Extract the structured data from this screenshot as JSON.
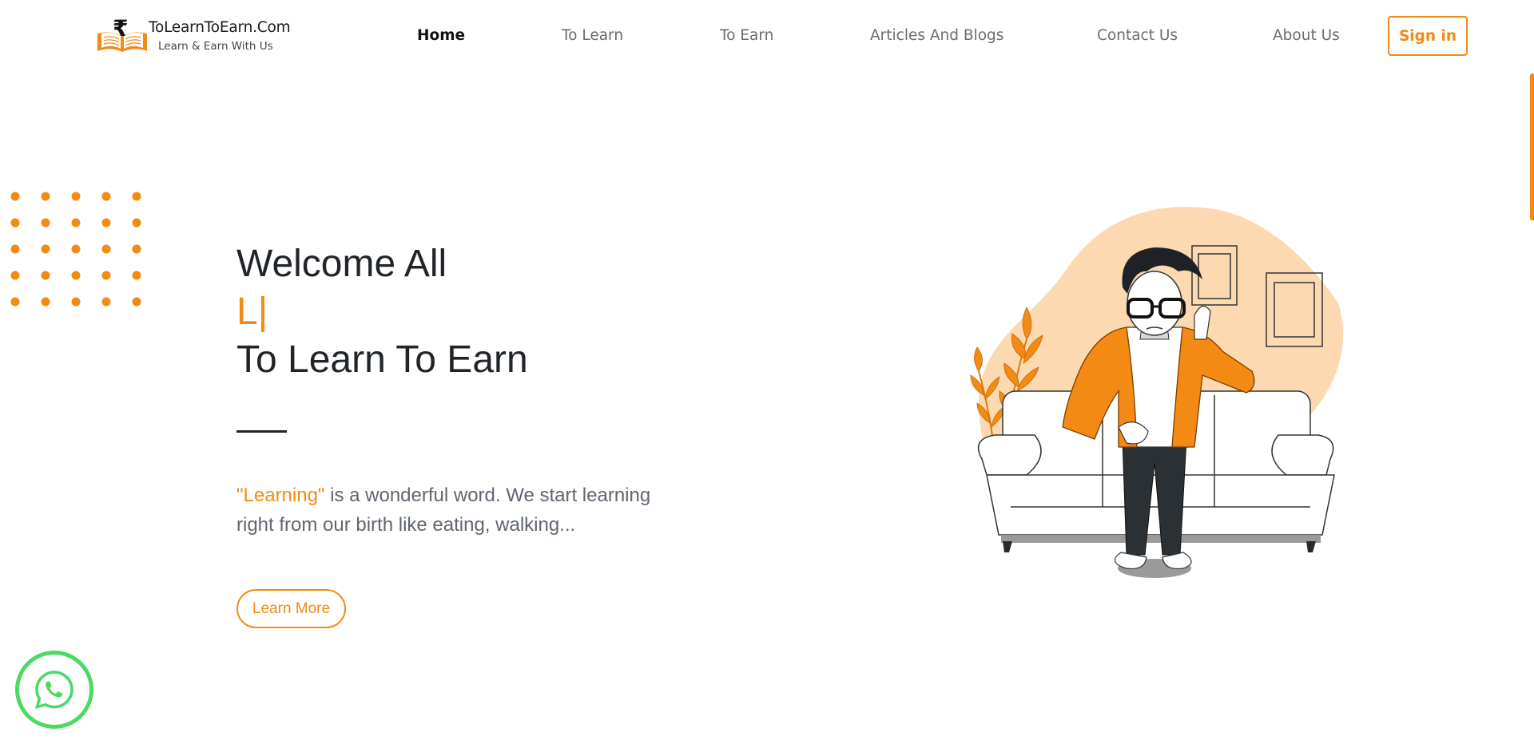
{
  "brand": {
    "name": "ToLearnToEarn.Com",
    "tagline": "Learn & Earn With Us",
    "logo_icon": "open-book-rupee-icon"
  },
  "nav": {
    "items": [
      {
        "label": "Home",
        "active": true
      },
      {
        "label": "To Learn",
        "active": false
      },
      {
        "label": "To Earn",
        "active": false
      },
      {
        "label": "Articles And Blogs",
        "active": false
      },
      {
        "label": "Contact Us",
        "active": false
      },
      {
        "label": "About Us",
        "active": false
      }
    ],
    "signin_label": "Sign in"
  },
  "hero": {
    "line1": "Welcome All",
    "line2": "L|",
    "line3": "To Learn To Earn",
    "desc_highlight": "\"Learning\"",
    "desc_rest": " is a wonderful word. We start learning right from our birth like eating, walking...",
    "cta_label": "Learn More"
  },
  "illustration": {
    "icon": "man-on-sofa-illustration"
  },
  "floating": {
    "whatsapp_icon": "whatsapp-icon"
  },
  "colors": {
    "accent": "#f28a14",
    "text_dark": "#212529",
    "text_muted": "#5f6670",
    "nav_muted": "#6c6c6c",
    "blob": "#fcd9b0",
    "whatsapp": "#4cd964"
  }
}
